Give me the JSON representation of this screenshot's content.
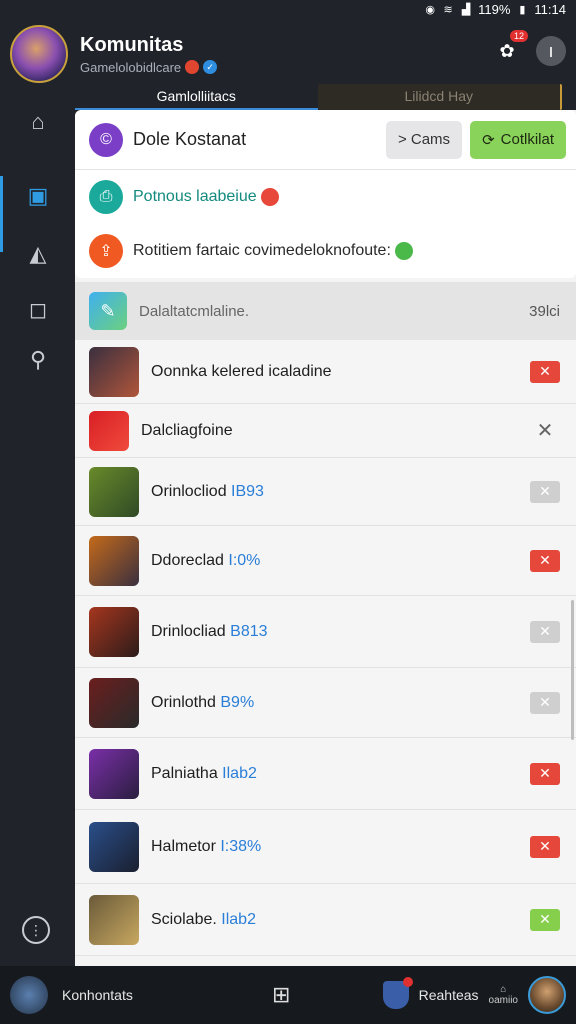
{
  "status_bar": {
    "battery_text": "119%",
    "time": "11:14"
  },
  "header": {
    "title": "Komunitas",
    "subtitle": "Gamelolobidlcare",
    "notification_badge": "12"
  },
  "tabs": [
    {
      "label": "Gamlolliitacs",
      "active": true
    },
    {
      "label": "Lilidcd Hay",
      "active": false
    }
  ],
  "rail": {
    "icons": [
      "server-icon",
      "chat-icon",
      "map-icon",
      "square-icon",
      "search-icon"
    ]
  },
  "top_card": {
    "title": "Dole Kostanat",
    "secondary_button": "> Cams",
    "primary_button": "Cotlkilat"
  },
  "notices": [
    {
      "text": "Potnous laabeiue",
      "color": "#138a7e"
    },
    {
      "text": "Rotitiem fartaic covimedeloknofoute:",
      "color": "#2a2a2a"
    }
  ],
  "list_header": {
    "label": "Dalaltatcmlaline.",
    "count": "39lci"
  },
  "games": [
    {
      "label": "Oonnka kelered icaladine",
      "highlight": "",
      "action": "red",
      "thumb": [
        "#3a2f3f",
        "#b0563a"
      ]
    },
    {
      "label": "Dalcliagfoine",
      "highlight": "",
      "action": "plain",
      "thumb": [
        "#d81f26",
        "#f04b3b"
      ]
    },
    {
      "label": "Orinlocliod ",
      "highlight": "IB93",
      "action": "grey",
      "thumb": [
        "#6a8a2a",
        "#2f4a26"
      ]
    },
    {
      "label": "Ddoreclad ",
      "highlight": "I:0%",
      "action": "red",
      "thumb": [
        "#c46a1a",
        "#3a2f3f"
      ]
    },
    {
      "label": "Drinlocliad ",
      "highlight": "B813",
      "action": "grey",
      "thumb": [
        "#a5361e",
        "#2c1c1a"
      ]
    },
    {
      "label": "Orinlothd ",
      "highlight": "B9%",
      "action": "grey",
      "thumb": [
        "#6b1e1e",
        "#2a2a2a"
      ]
    },
    {
      "label": "Palniatha ",
      "highlight": "Ilab2",
      "action": "red",
      "thumb": [
        "#7a2fa8",
        "#2a1e3f"
      ]
    },
    {
      "label": "Halmetor ",
      "highlight": "I:38%",
      "action": "red",
      "thumb": [
        "#2a4f8a",
        "#1a1f2f"
      ]
    },
    {
      "label": "Sciolabe. ",
      "highlight": "Ilab2",
      "action": "green",
      "thumb": [
        "#6a5a3a",
        "#c8a860"
      ]
    }
  ],
  "bottom_bar": {
    "left_label": "Konhontats",
    "right_label": "Reahteas",
    "small_label": "oamiio"
  }
}
